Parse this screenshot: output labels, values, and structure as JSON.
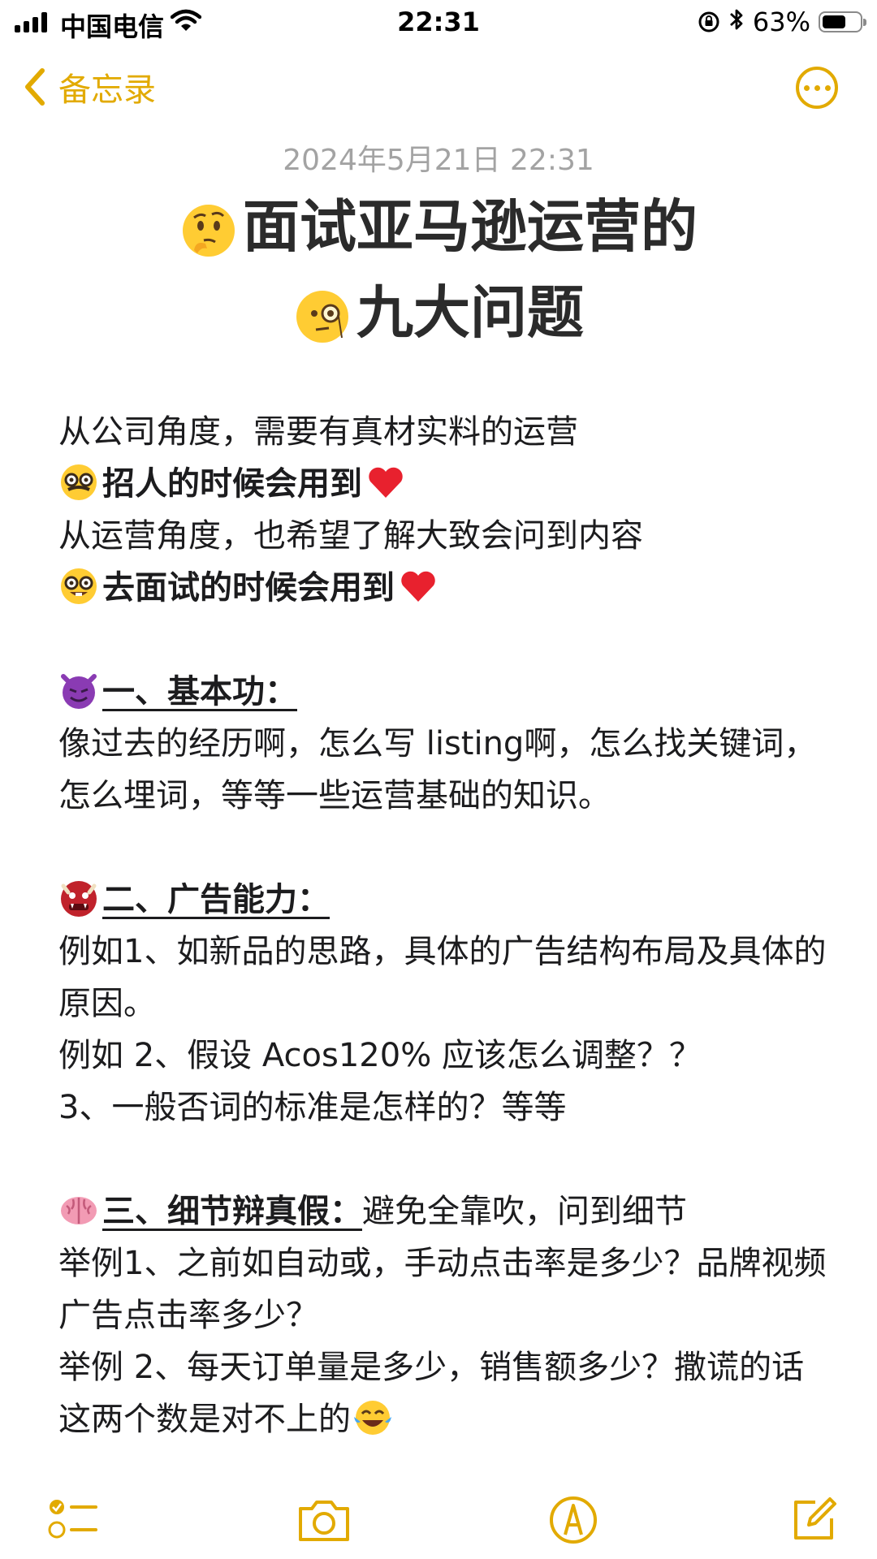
{
  "status_bar": {
    "carrier": "中国电信",
    "time": "22:31",
    "battery_percent": "63%",
    "battery_level": 0.63,
    "icons": [
      "signal-icon",
      "wifi-icon",
      "orientation-lock-icon",
      "bluetooth-icon",
      "battery-icon"
    ]
  },
  "nav": {
    "back_label": "备忘录",
    "accent_color": "#e2aa00"
  },
  "note": {
    "date": "2024年5月21日 22:31",
    "title_line1": "面试亚马逊运营的",
    "title_line2": "九大问题",
    "intro": {
      "line1": "从公司角度，需要有真材实料的运营",
      "line2": "招人的时候会用到",
      "line3": "从运营角度，也希望了解大致会问到内容",
      "line4": "去面试的时候会用到"
    },
    "sections": [
      {
        "heading": "一、基本功：",
        "text": "像过去的经历啊，怎么写 listing啊，怎么找关键词，怎么埋词，等等一些运营基础的知识。"
      },
      {
        "heading": "二、广告能力：",
        "lines": [
          "例如1、如新品的思路，具体的广告结构布局及具体的原因。",
          "例如 2、假设 Acos120% 应该怎么调整？？",
          "3、一般否词的标准是怎样的？等等"
        ]
      },
      {
        "heading": "三、细节辩真假：",
        "inline": "避免全靠吹，问到细节",
        "lines": [
          "举例1、之前如自动或，手动点击率是多少？品牌视频广告点击率多少？",
          "举例 2、每天订单量是多少，销售额多少？撒谎的话这两个数是对不上的"
        ]
      }
    ]
  },
  "toolbar": {
    "icons": [
      "checklist-icon",
      "camera-icon",
      "markup-icon",
      "compose-icon"
    ]
  }
}
